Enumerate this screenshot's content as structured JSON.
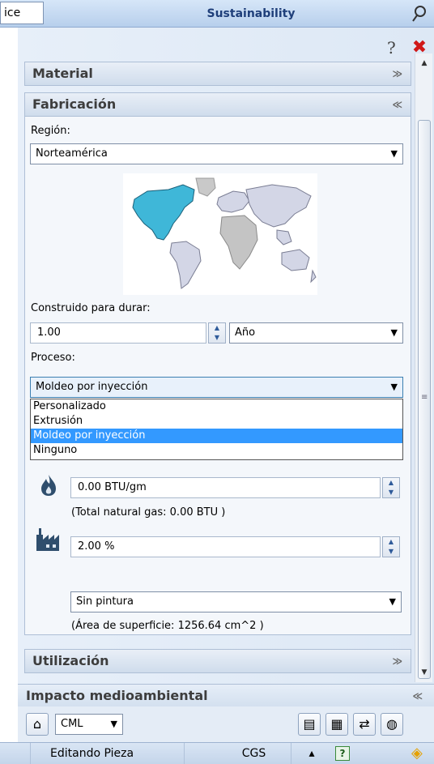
{
  "titlebar": {
    "left_tab": "ice",
    "title": "Sustainability"
  },
  "sections": {
    "material": "Material",
    "fabricacion": "Fabricación",
    "utilizacion": "Utilización"
  },
  "fabricacion": {
    "region_label": "Región:",
    "region_value": "Norteamérica",
    "built_to_last_label": "Construido para durar:",
    "built_to_last_value": "1.00",
    "unit_value": "Año",
    "process_label": "Proceso:",
    "process_value": "Moldeo por inyección",
    "process_options": [
      "Personalizado",
      "Extrusión",
      "Moldeo por inyección",
      "Ninguno"
    ],
    "process_selected_index": 2,
    "energy_value": "0.00 BTU/gm",
    "energy_note": "(Total natural gas: 0.00 BTU )",
    "scrap_value": "2.00 %",
    "paint_value": "Sin pintura",
    "surface_note": "(Área de superficie: 1256.64 cm^2 )"
  },
  "impact": {
    "header": "Impacto medioambiental",
    "method_value": "CML"
  },
  "statusbar": {
    "mode": "Editando Pieza",
    "units": "CGS"
  },
  "colors": {
    "accent": "#3399ff",
    "close": "#d01818",
    "header_text": "#1f3f7a"
  },
  "icons": [
    "pin-icon",
    "help-icon",
    "close-icon",
    "flame-icon",
    "factory-icon",
    "home-icon",
    "report-icon",
    "compare-icon",
    "swap-icon",
    "globe-icon",
    "help-status-icon",
    "tag-icon"
  ]
}
